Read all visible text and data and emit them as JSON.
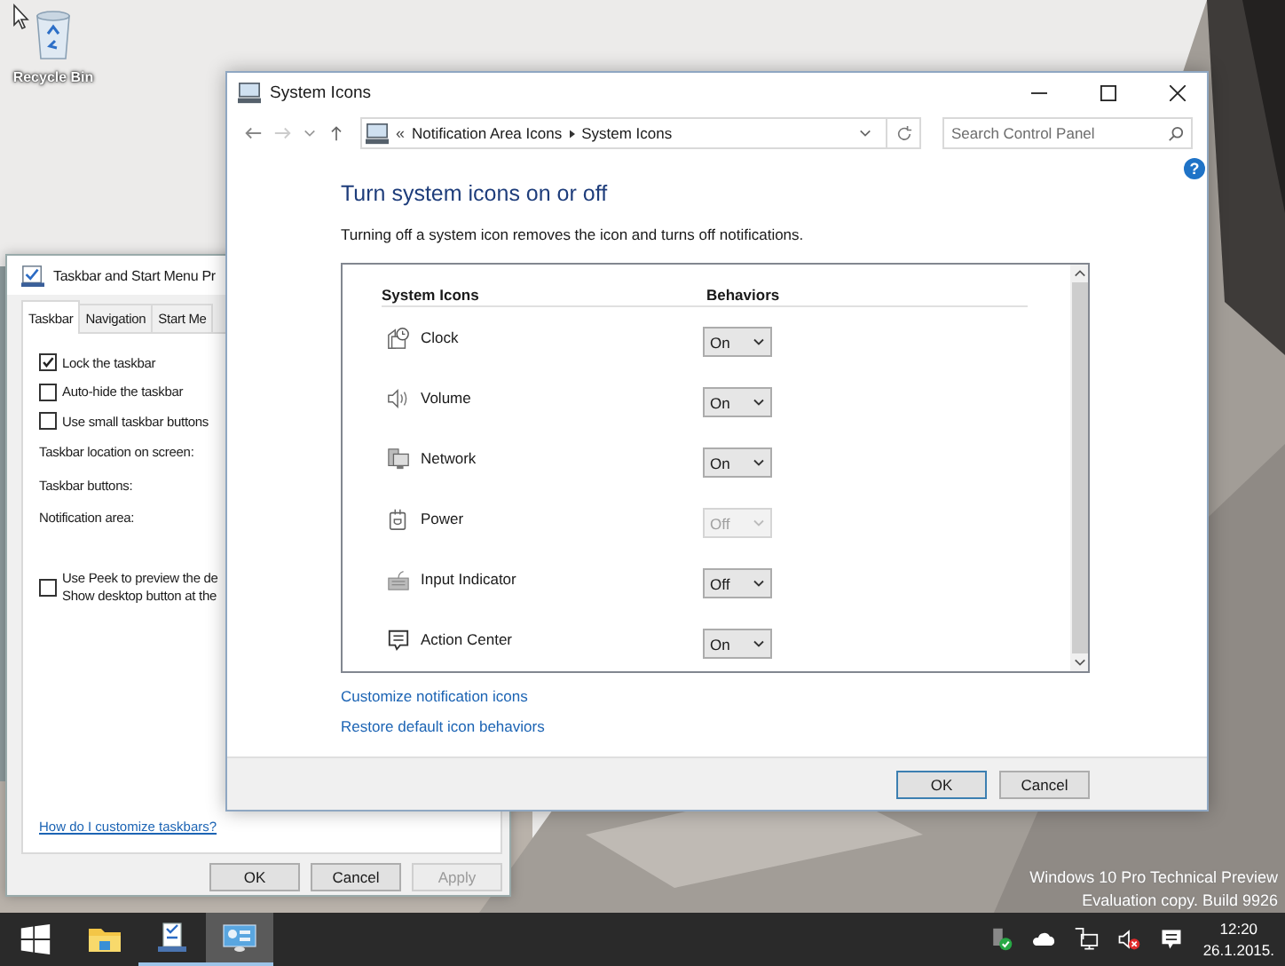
{
  "desktop": {
    "icons": [
      {
        "label": "Recycle Bin"
      }
    ],
    "watermark": [
      "Windows 10 Pro Technical Preview",
      "Evaluation copy. Build 9926"
    ]
  },
  "taskbar_properties": {
    "title": "Taskbar and Start Menu Pr",
    "tabs": [
      {
        "label": "Taskbar",
        "selected": true
      },
      {
        "label": "Navigation",
        "selected": false
      },
      {
        "label": "Start Me",
        "selected": false
      }
    ],
    "options": [
      {
        "kind": "checkbox",
        "label": "Lock the taskbar",
        "checked": true
      },
      {
        "kind": "checkbox",
        "label": "Auto-hide the taskbar",
        "checked": false
      },
      {
        "kind": "checkbox",
        "label": "Use small taskbar buttons",
        "checked": false
      },
      {
        "kind": "label",
        "label": "Taskbar location on screen:"
      },
      {
        "kind": "label",
        "label": "Taskbar buttons:"
      },
      {
        "kind": "label",
        "label": "Notification area:"
      },
      {
        "kind": "wrapped-checkbox",
        "lines": [
          "Use Peek to preview the de",
          "Show desktop button at the"
        ],
        "checked": false
      }
    ],
    "link": "How do I customize taskbars?",
    "buttons": [
      {
        "label": "OK",
        "disabled": false
      },
      {
        "label": "Cancel",
        "disabled": false
      },
      {
        "label": "Apply",
        "disabled": true
      }
    ]
  },
  "system_icons": {
    "title": "System Icons",
    "address": {
      "overflow": "«",
      "crumbs": [
        "Notification Area Icons",
        "System Icons"
      ]
    },
    "search": {
      "placeholder": "Search Control Panel"
    },
    "help": "?",
    "heading": "Turn system icons on or off",
    "description": "Turning off a system icon removes the icon and turns off notifications.",
    "columns": [
      "System Icons",
      "Behaviors"
    ],
    "rows": [
      {
        "kind": "clock",
        "name": "Clock",
        "value": "On",
        "disabled": false
      },
      {
        "kind": "volume",
        "name": "Volume",
        "value": "On",
        "disabled": false
      },
      {
        "kind": "network",
        "name": "Network",
        "value": "On",
        "disabled": false
      },
      {
        "kind": "power",
        "name": "Power",
        "value": "Off",
        "disabled": true
      },
      {
        "kind": "input",
        "name": "Input Indicator",
        "value": "Off",
        "disabled": false
      },
      {
        "kind": "action-center",
        "name": "Action Center",
        "value": "On",
        "disabled": false
      }
    ],
    "links": [
      "Customize notification icons",
      "Restore default icon behaviors"
    ],
    "buttons": [
      {
        "label": "OK",
        "default": true
      },
      {
        "label": "Cancel",
        "default": false
      }
    ]
  },
  "taskbar": {
    "apps": [
      {
        "kind": "explorer",
        "active": false,
        "running": false
      },
      {
        "kind": "properties",
        "active": false,
        "running": true
      },
      {
        "kind": "control-panel",
        "active": true,
        "running": true
      }
    ],
    "clock": {
      "time": "12:20",
      "date": "26.1.2015."
    }
  }
}
